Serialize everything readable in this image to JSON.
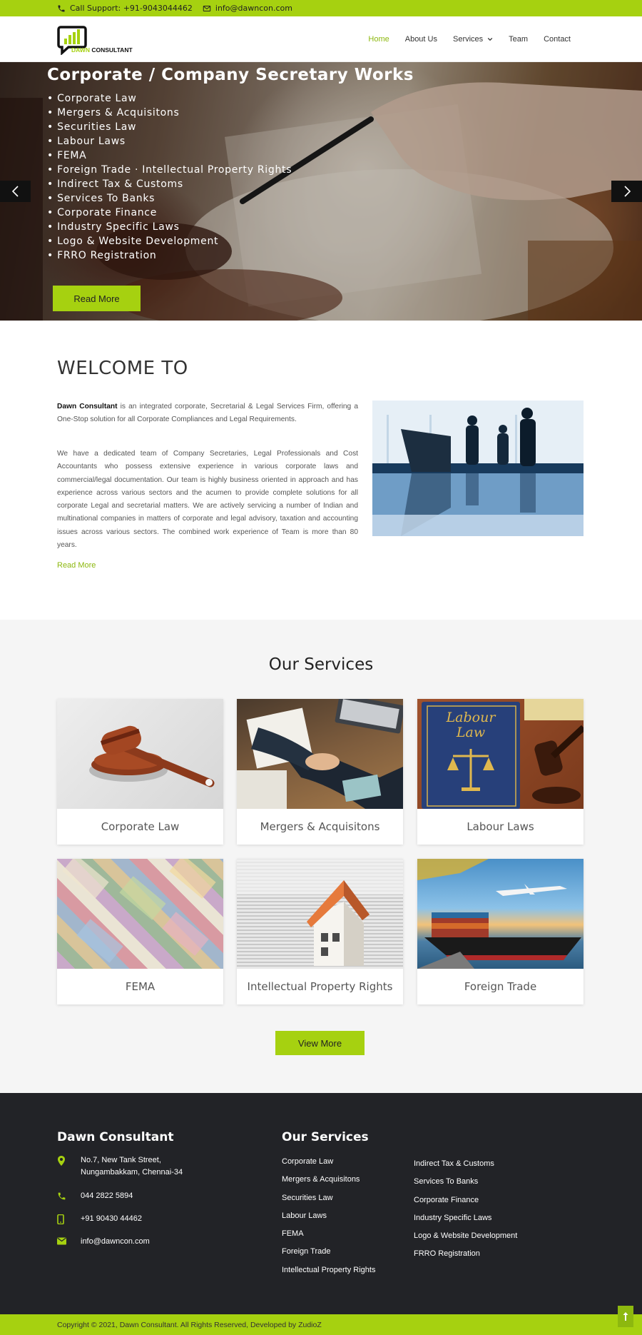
{
  "topbar": {
    "phone_text": "Call Support: +91-9043044462",
    "email_text": "info@dawncon.com",
    "phone_icon": "phone-icon",
    "email_icon": "envelope-icon"
  },
  "brand": {
    "name_part1": "DAWN",
    "name_part2": "CONSULTANT",
    "accent_color": "#a6d110"
  },
  "nav": {
    "items": [
      {
        "label": "Home",
        "active": true
      },
      {
        "label": "About Us"
      },
      {
        "label": "Services",
        "has_dropdown": true
      },
      {
        "label": "Team"
      },
      {
        "label": "Contact"
      }
    ]
  },
  "hero": {
    "title": "Corporate / Company Secretary Works",
    "items": [
      "• Corporate Law",
      "• Mergers & Acquisitons",
      "• Securities Law",
      "• Labour Laws",
      "• FEMA",
      "• Foreign Trade · Intellectual Property Rights",
      "• Indirect Tax & Customs",
      "• Services To Banks",
      "• Corporate Finance",
      "• Industry Specific Laws",
      "• Logo & Website Development",
      "• FRRO Registration"
    ],
    "button_label": "Read More",
    "prev_icon": "chevron-left-icon",
    "next_icon": "chevron-right-icon"
  },
  "welcome": {
    "title": "WELCOME TO",
    "company_name": "Dawn Consultant",
    "p1_rest": " is an integrated corporate, Secretarial & Legal Services Firm, offering a One-Stop solution for all Corporate Compliances and Legal Requirements.",
    "p2": "We have a dedicated team of Company Secretaries, Legal Professionals and Cost Accountants who possess extensive experience in various corporate laws and commercial/legal documentation. Our team is highly business oriented in approach and has experience across various sectors and the acumen to provide complete solutions for all corporate Legal and secretarial matters. We are actively servicing a number of Indian and multinational companies in matters of corporate and legal advisory, taxation and accounting issues across various sectors. The combined work experience of Team is more than 80 years.",
    "link_label": "Read More"
  },
  "services": {
    "title": "Our Services",
    "cards": [
      {
        "label": "Corporate Law"
      },
      {
        "label": "Mergers & Acquisitons"
      },
      {
        "label": "Labour Laws"
      },
      {
        "label": "FEMA"
      },
      {
        "label": "Intellectual Property Rights"
      },
      {
        "label": "Foreign Trade"
      }
    ],
    "labour_book_line1": "Labour",
    "labour_book_line2": "Law",
    "view_more_label": "View More"
  },
  "footer": {
    "company_title": "Dawn Consultant",
    "address_line1": "No.7, New Tank Street,",
    "address_line2": "Nungambakkam, Chennai-34",
    "phone": "044 2822 5894",
    "mobile": "+91 90430 44462",
    "email": "info@dawncon.com",
    "services_title": "Our Services",
    "links_col1": [
      "Corporate Law",
      "Mergers & Acquisitons",
      "Securities Law",
      "Labour Laws",
      "FEMA",
      "Foreign Trade",
      "Intellectual Property Rights"
    ],
    "links_col2": [
      "Indirect Tax & Customs",
      "Services To Banks",
      "Corporate Finance",
      "Industry Specific Laws",
      "Logo & Website Development",
      "FRRO Registration"
    ]
  },
  "copyright": "Copyright © 2021, Dawn Consultant. All Rights Reserved, Developed by ZudioZ"
}
